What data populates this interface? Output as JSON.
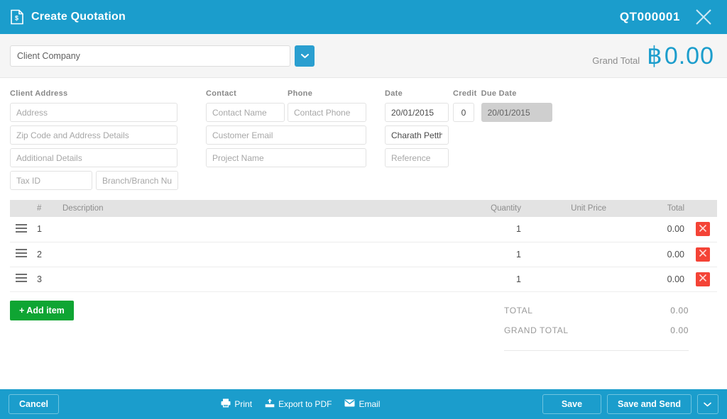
{
  "titlebar": {
    "icon": "document-dollar-icon",
    "title": "Create Quotation",
    "quote_number": "QT000001",
    "close_icon": "close-icon"
  },
  "subheader": {
    "company_placeholder": "Client Company",
    "company_value": "",
    "dropdown_icon": "chevron-down-icon",
    "grand_total_label": "Grand Total",
    "currency_symbol": "฿",
    "grand_total_value": "0.00"
  },
  "form": {
    "client_address": {
      "label": "Client Address",
      "address_placeholder": "Address",
      "zip_placeholder": "Zip Code and Address Details",
      "additional_placeholder": "Additional Details",
      "tax_id_placeholder": "Tax ID",
      "branch_placeholder": "Branch/Branch Number"
    },
    "contact": {
      "label": "Contact",
      "name_placeholder": "Contact Name",
      "email_placeholder": "Customer Email",
      "project_placeholder": "Project Name"
    },
    "phone": {
      "label": "Phone",
      "phone_placeholder": "Contact Phone"
    },
    "date": {
      "label": "Date",
      "value": "20/01/2015",
      "salesperson_value": "Charath Petthong",
      "reference_placeholder": "Reference"
    },
    "credit": {
      "label": "Credit",
      "value": "0"
    },
    "due_date": {
      "label": "Due Date",
      "value": "20/01/2015"
    }
  },
  "items_table": {
    "columns": {
      "number": "#",
      "description": "Description",
      "quantity": "Quantity",
      "unit_price": "Unit Price",
      "total": "Total"
    },
    "rows": [
      {
        "number": "1",
        "description": "",
        "quantity": "1",
        "unit_price": "",
        "total": "0.00",
        "handle_icon": "drag-handle-icon",
        "delete_icon": "delete-x-icon"
      },
      {
        "number": "2",
        "description": "",
        "quantity": "1",
        "unit_price": "",
        "total": "0.00",
        "handle_icon": "drag-handle-icon",
        "delete_icon": "delete-x-icon"
      },
      {
        "number": "3",
        "description": "",
        "quantity": "1",
        "unit_price": "",
        "total": "0.00",
        "handle_icon": "drag-handle-icon",
        "delete_icon": "delete-x-icon"
      }
    ]
  },
  "actions": {
    "add_item_label": "+ Add item"
  },
  "totals": {
    "total_label": "TOTAL",
    "total_value": "0.00",
    "grand_total_label": "GRAND TOTAL",
    "grand_total_value": "0.00"
  },
  "bottombar": {
    "cancel_label": "Cancel",
    "print_label": "Print",
    "print_icon": "printer-icon",
    "export_label": "Export to PDF",
    "export_icon": "export-pdf-icon",
    "email_label": "Email",
    "email_icon": "envelope-icon",
    "save_label": "Save",
    "save_send_label": "Save and Send",
    "caret_icon": "chevron-down-icon"
  },
  "colors": {
    "brand_blue": "#1b9dcc",
    "accent_green": "#0fa533",
    "danger_red": "#f44336",
    "header_grey": "#e3e3e3"
  }
}
